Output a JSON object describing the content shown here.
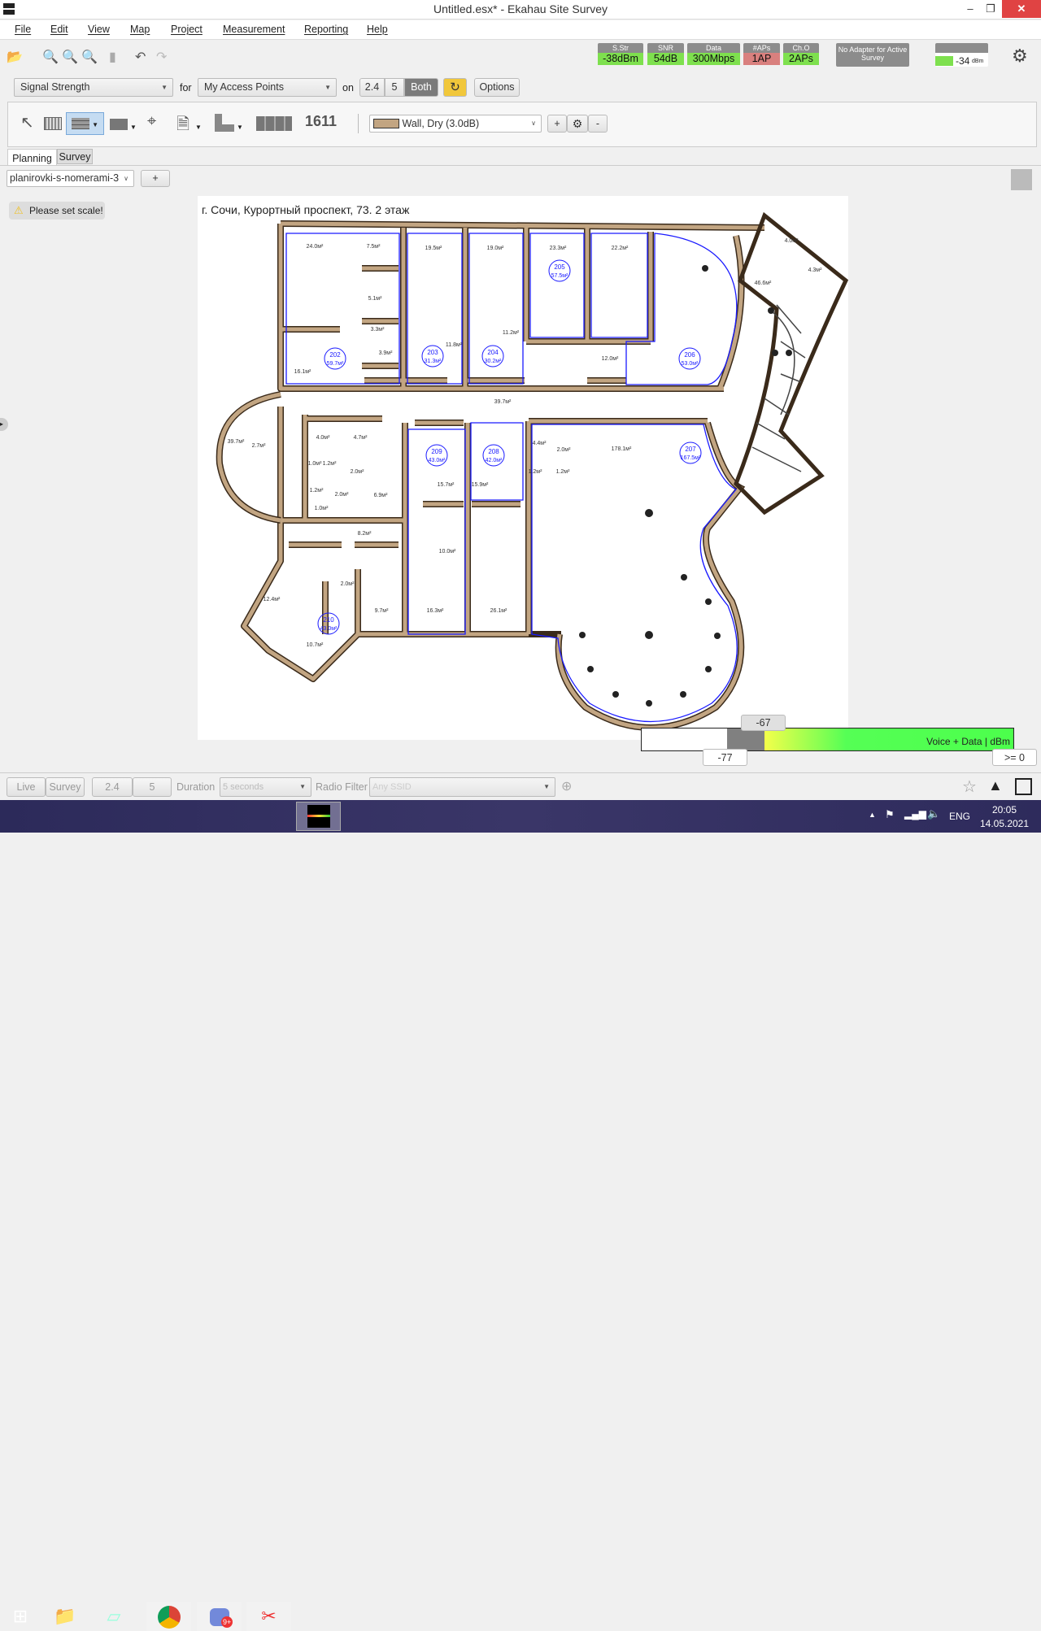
{
  "window": {
    "title": "Untitled.esx* - Ekahau Site Survey",
    "minimize": "‒",
    "restore": "❐",
    "close": "✕"
  },
  "menu": [
    "File",
    "Edit",
    "View",
    "Map",
    "Project",
    "Measurement",
    "Reporting",
    "Help"
  ],
  "status": [
    {
      "label": "S.Str",
      "value": "-38dBm",
      "color": "#7ee04e"
    },
    {
      "label": "SNR",
      "value": "54dB",
      "color": "#7ee04e"
    },
    {
      "label": "Data",
      "value": "300Mbps",
      "color": "#7ee04e"
    },
    {
      "label": "#APs",
      "value": "1AP",
      "color": "#d9807e"
    },
    {
      "label": "Ch.O",
      "value": "2APs",
      "color": "#7ee04e"
    }
  ],
  "adapter": "No Adapter for Active Survey",
  "signal_meter": {
    "value": "-34",
    "unit": "dBm"
  },
  "viz": {
    "type": "Signal Strength",
    "for_label": "for",
    "for_value": "My Access Points",
    "on_label": "on",
    "bands": [
      "2.4",
      "5",
      "Both"
    ],
    "active_band": "Both",
    "options": "Options"
  },
  "tools": {
    "wall_type": "Wall, Dry (3.0dB)",
    "wall_color": "#c2a582",
    "plus": "+",
    "minus": "-",
    "channel_icon_text": "1611"
  },
  "tabs": {
    "planning": "Planning",
    "survey": "Survey"
  },
  "map": {
    "selected": "planirovki-s-nomerami-3",
    "add": "+",
    "scale_warning": "Please set scale!"
  },
  "plan": {
    "title": "г. Сочи, Курортный  проспект, 73. 2 этаж",
    "rooms": [
      {
        "n": "202",
        "a": "59.7м²"
      },
      {
        "n": "203",
        "a": "31.3м²"
      },
      {
        "n": "204",
        "a": "30.2м²"
      },
      {
        "n": "205",
        "a": "57.5м²"
      },
      {
        "n": "206",
        "a": "53.0м²"
      },
      {
        "n": "207",
        "a": "167.5м²"
      },
      {
        "n": "208",
        "a": "42.0м²"
      },
      {
        "n": "209",
        "a": "43.0м²"
      },
      {
        "n": "210",
        "a": "43.0м²"
      }
    ],
    "areas": [
      "24.0м²",
      "7.5м²",
      "19.5м²",
      "19.0м²",
      "23.3м²",
      "22.2м²",
      "46.6м²",
      "4.3м²",
      "4.0м²",
      "5.1м²",
      "3.3м²",
      "3.9м²",
      "11.8м²",
      "11.2м²",
      "12.0м²",
      "16.1м²",
      "39.7м²",
      "39.7м²",
      "2.7м²",
      "4.0м²",
      "4.7м²",
      "1.0м²",
      "1.2м²",
      "2.0м²",
      "1.2м²",
      "2.0м²",
      "6.9м²",
      "1.0м²",
      "4.4м²",
      "2.0м²",
      "1.2м²",
      "1.2м²",
      "178.1м²",
      "15.7м²",
      "15.9м²",
      "8.2м²",
      "10.0м²",
      "2.0м²",
      "12.4м²",
      "9.7м²",
      "16.3м²",
      "26.1м²",
      "10.7м²"
    ]
  },
  "legend": {
    "top": "-67",
    "low": "-77",
    "high": ">= 0",
    "label": "Voice + Data |  dBm"
  },
  "bottombar": {
    "live": "Live",
    "survey": "Survey",
    "b24": "2.4",
    "b5": "5",
    "duration_label": "Duration",
    "duration": "5 seconds",
    "radio_label": "Radio Filter",
    "ssid": "Any SSID"
  },
  "taskbar": {
    "lang": "ENG",
    "time": "20:05",
    "date": "14.05.2021",
    "discord_badge": "9+"
  }
}
